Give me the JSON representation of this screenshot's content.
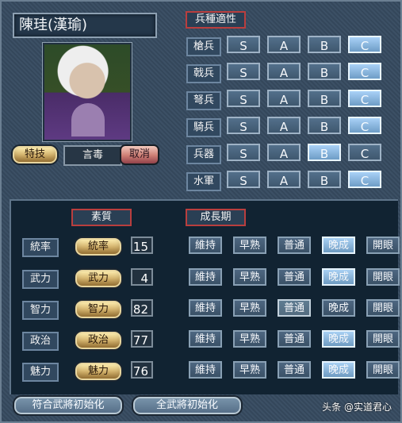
{
  "character": {
    "name": "陳珪(漢瑜)",
    "skill_button": "特技",
    "skill_value": "言毒",
    "cancel": "取消"
  },
  "unit_aptitude": {
    "title": "兵種適性",
    "rows": [
      {
        "label": "槍兵",
        "selected": "C"
      },
      {
        "label": "戟兵",
        "selected": "C"
      },
      {
        "label": "弩兵",
        "selected": "C"
      },
      {
        "label": "騎兵",
        "selected": "C"
      },
      {
        "label": "兵器",
        "selected": "B"
      },
      {
        "label": "水軍",
        "selected": "C"
      }
    ],
    "grades": [
      "S",
      "A",
      "B",
      "C"
    ]
  },
  "stats": {
    "quality_title": "素質",
    "growth_title": "成長期",
    "rows": [
      {
        "label": "統率",
        "button": "統率",
        "value": 15,
        "selected_growth": "晚成"
      },
      {
        "label": "武力",
        "button": "武力",
        "value": 4,
        "selected_growth": "晚成"
      },
      {
        "label": "智力",
        "button": "智力",
        "value": 82,
        "selected_growth": "普通"
      },
      {
        "label": "政治",
        "button": "政治",
        "value": 77,
        "selected_growth": "晚成"
      },
      {
        "label": "魅力",
        "button": "魅力",
        "value": 76,
        "selected_growth": "晚成"
      }
    ],
    "growth_options": [
      "維持",
      "早熟",
      "普通",
      "晚成",
      "開眼"
    ]
  },
  "buttons": {
    "left": "符合武將初始化",
    "right": "全武將初始化"
  },
  "watermark": "头条 @实道君心"
}
